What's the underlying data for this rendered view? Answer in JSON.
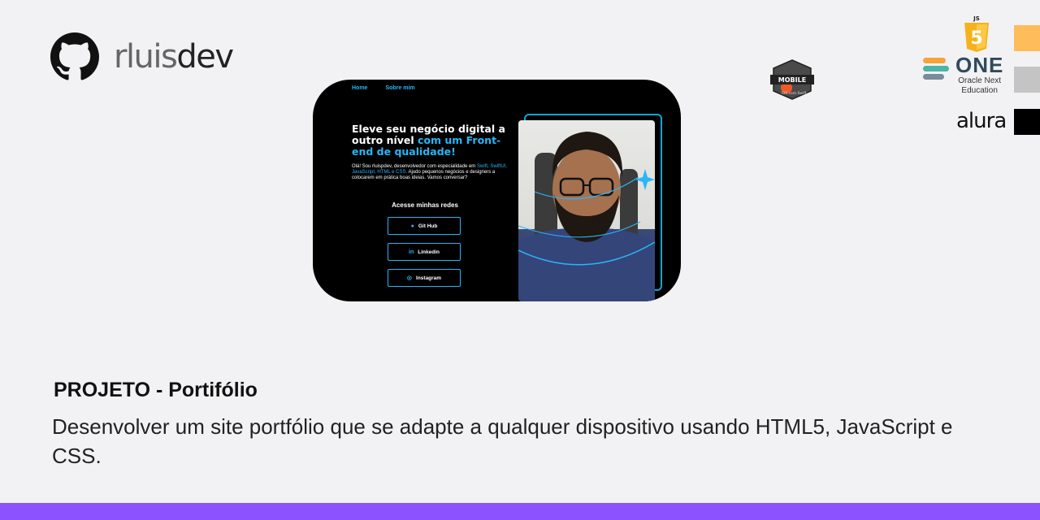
{
  "brand": {
    "name_light": "rluis",
    "name_bold": "dev",
    "icon": "github-icon"
  },
  "preview": {
    "nav": [
      "Home",
      "Sobre mim"
    ],
    "headline_white": "Eleve seu negócio digital a outro nível",
    "headline_blue": "com um Front-end de qualidade!",
    "intro_pre": "Olá! Sou rluispdev, desenvolvedor com especialidade em",
    "intro_tech": "Swift, SwiftUI, JavaScript, HTML e CSS.",
    "intro_post": "Ajudo pequenos negócios e designers a colocarem em prática boas ideias. Vamos conversar?",
    "social_title": "Acesse minhas redes",
    "buttons": [
      {
        "label": "Git Hub",
        "icon": "github-icon"
      },
      {
        "label": "Linkedin",
        "icon": "linkedin-icon"
      },
      {
        "label": "Instagram",
        "icon": "instagram-icon"
      }
    ]
  },
  "logos": {
    "mobile_badge": {
      "line1": "MOBILE",
      "line2": "iOS com Swift"
    },
    "js": {
      "label": "JS",
      "mark": "5"
    },
    "one": {
      "big": "ONE",
      "line1": "Oracle Next",
      "line2": "Education",
      "stripes": [
        "#f6a33a",
        "#4fb3a6",
        "#7a8a9a"
      ]
    },
    "alura": "alura",
    "swatches": [
      "#ffbc5a",
      "#c4c4c4",
      "#000000"
    ]
  },
  "project": {
    "title": "PROJETO - Portifólio",
    "description": "Desenvolver um site portfólio que se adapte a qualquer dispositivo usando HTML5, JavaScript e CSS."
  },
  "colors": {
    "accent": "#8c52ff",
    "highlight": "#29b6f6",
    "background": "#f2f2f4"
  }
}
